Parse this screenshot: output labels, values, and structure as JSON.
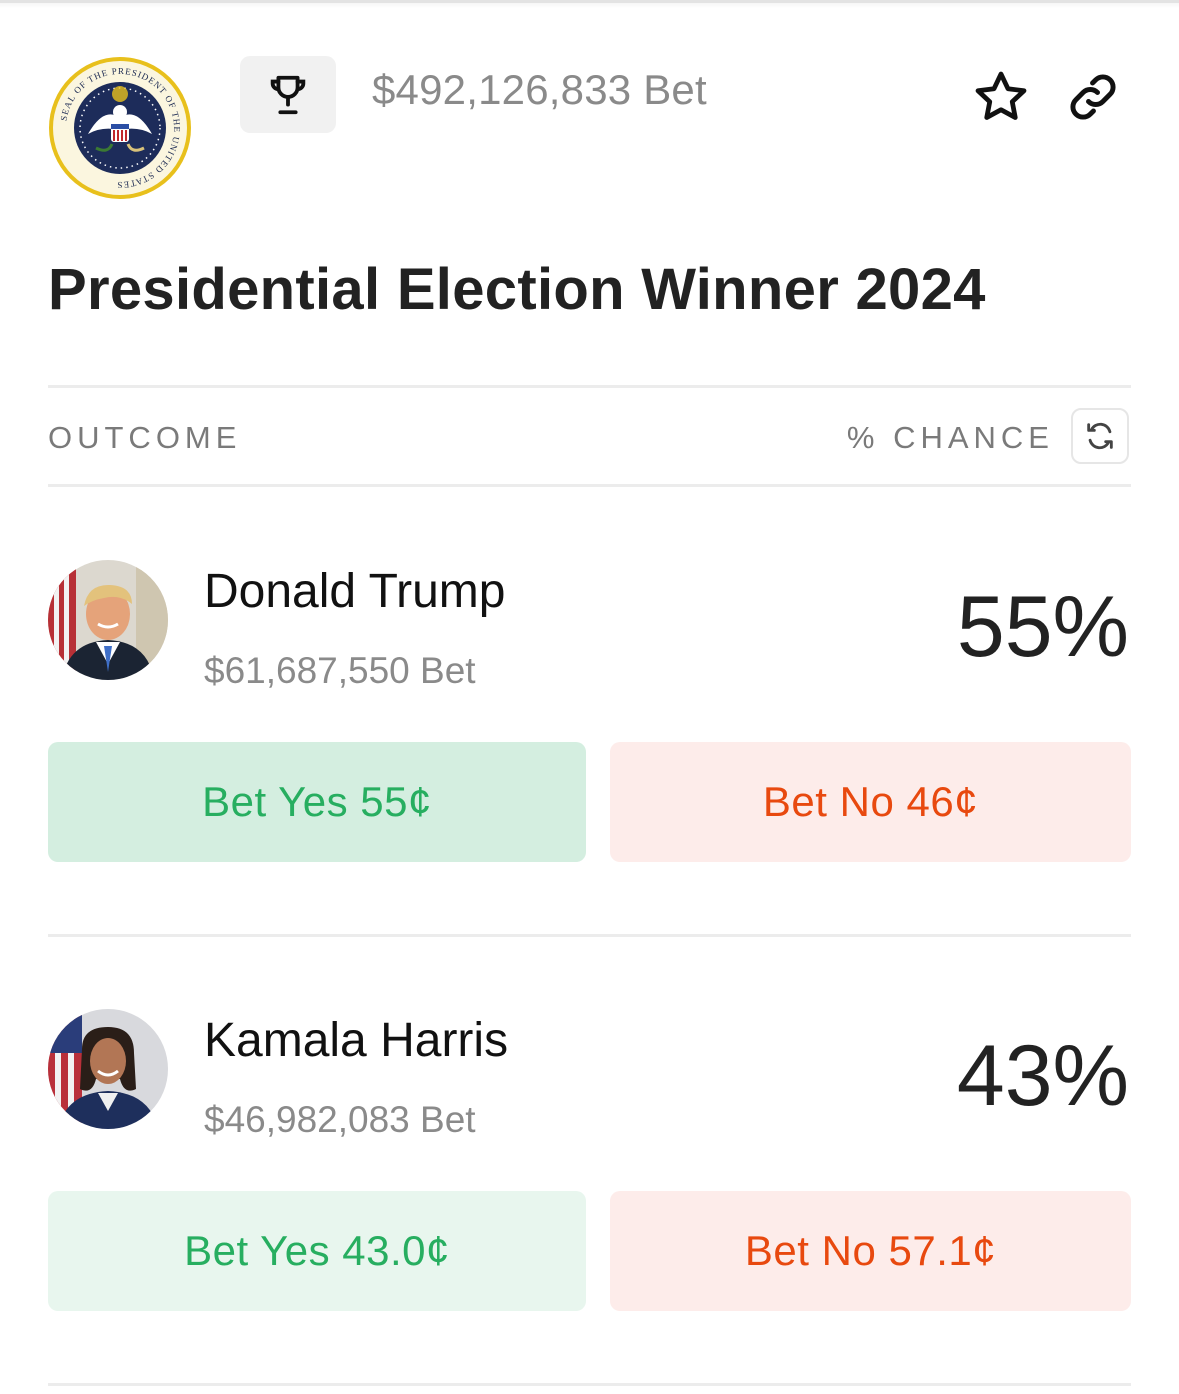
{
  "header": {
    "seal": {
      "icon": "presidential-seal-icon",
      "ring_text": "SEAL OF THE PRESIDENT OF THE UNITED STATES"
    },
    "trophy_icon": "trophy-icon",
    "total_bet": "$492,126,833 Bet",
    "favorite_icon": "star-icon",
    "share_icon": "link-icon"
  },
  "title": "Presidential Election Winner 2024",
  "columns": {
    "outcome": "OUTCOME",
    "chance": "% CHANCE",
    "refresh_icon": "refresh-icon"
  },
  "candidates": [
    {
      "name": "Donald Trump",
      "bet": "$61,687,550 Bet",
      "chance": "55%",
      "yes_label": "Bet Yes 55¢",
      "no_label": "Bet No 46¢"
    },
    {
      "name": "Kamala Harris",
      "bet": "$46,982,083 Bet",
      "chance": "43%",
      "yes_label": "Bet Yes 43.0¢",
      "no_label": "Bet No 57.1¢"
    }
  ],
  "colors": {
    "yes_text": "#27ae60",
    "no_text": "#e8490f",
    "yes_bg_active": "#d4eee0",
    "yes_bg": "#e8f6ee",
    "no_bg": "#fdecea"
  }
}
